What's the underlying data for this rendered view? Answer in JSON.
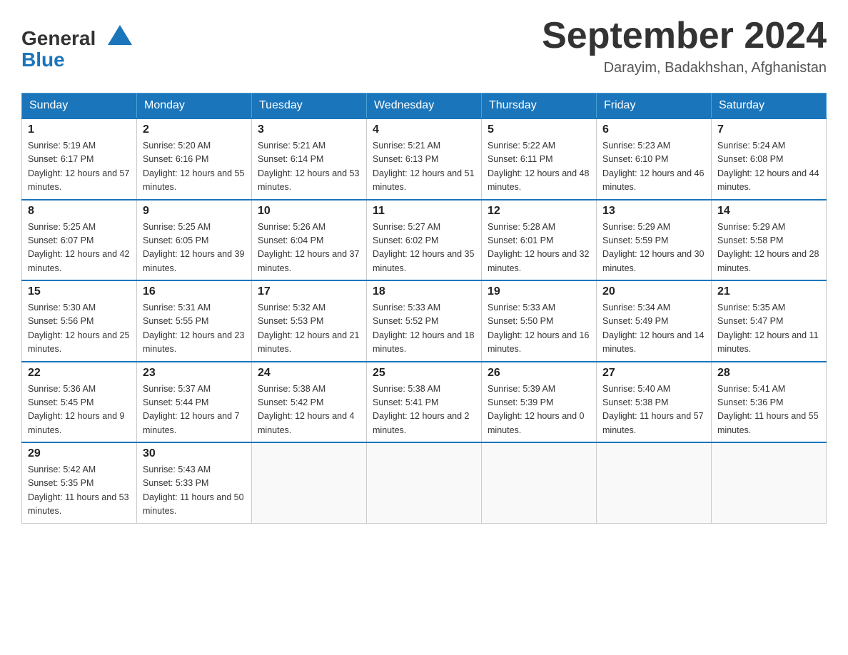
{
  "header": {
    "logo_general": "General",
    "logo_blue": "Blue",
    "main_title": "September 2024",
    "subtitle": "Darayim, Badakhshan, Afghanistan"
  },
  "days_of_week": [
    "Sunday",
    "Monday",
    "Tuesday",
    "Wednesday",
    "Thursday",
    "Friday",
    "Saturday"
  ],
  "weeks": [
    [
      {
        "day": "1",
        "sunrise": "5:19 AM",
        "sunset": "6:17 PM",
        "daylight": "12 hours and 57 minutes."
      },
      {
        "day": "2",
        "sunrise": "5:20 AM",
        "sunset": "6:16 PM",
        "daylight": "12 hours and 55 minutes."
      },
      {
        "day": "3",
        "sunrise": "5:21 AM",
        "sunset": "6:14 PM",
        "daylight": "12 hours and 53 minutes."
      },
      {
        "day": "4",
        "sunrise": "5:21 AM",
        "sunset": "6:13 PM",
        "daylight": "12 hours and 51 minutes."
      },
      {
        "day": "5",
        "sunrise": "5:22 AM",
        "sunset": "6:11 PM",
        "daylight": "12 hours and 48 minutes."
      },
      {
        "day": "6",
        "sunrise": "5:23 AM",
        "sunset": "6:10 PM",
        "daylight": "12 hours and 46 minutes."
      },
      {
        "day": "7",
        "sunrise": "5:24 AM",
        "sunset": "6:08 PM",
        "daylight": "12 hours and 44 minutes."
      }
    ],
    [
      {
        "day": "8",
        "sunrise": "5:25 AM",
        "sunset": "6:07 PM",
        "daylight": "12 hours and 42 minutes."
      },
      {
        "day": "9",
        "sunrise": "5:25 AM",
        "sunset": "6:05 PM",
        "daylight": "12 hours and 39 minutes."
      },
      {
        "day": "10",
        "sunrise": "5:26 AM",
        "sunset": "6:04 PM",
        "daylight": "12 hours and 37 minutes."
      },
      {
        "day": "11",
        "sunrise": "5:27 AM",
        "sunset": "6:02 PM",
        "daylight": "12 hours and 35 minutes."
      },
      {
        "day": "12",
        "sunrise": "5:28 AM",
        "sunset": "6:01 PM",
        "daylight": "12 hours and 32 minutes."
      },
      {
        "day": "13",
        "sunrise": "5:29 AM",
        "sunset": "5:59 PM",
        "daylight": "12 hours and 30 minutes."
      },
      {
        "day": "14",
        "sunrise": "5:29 AM",
        "sunset": "5:58 PM",
        "daylight": "12 hours and 28 minutes."
      }
    ],
    [
      {
        "day": "15",
        "sunrise": "5:30 AM",
        "sunset": "5:56 PM",
        "daylight": "12 hours and 25 minutes."
      },
      {
        "day": "16",
        "sunrise": "5:31 AM",
        "sunset": "5:55 PM",
        "daylight": "12 hours and 23 minutes."
      },
      {
        "day": "17",
        "sunrise": "5:32 AM",
        "sunset": "5:53 PM",
        "daylight": "12 hours and 21 minutes."
      },
      {
        "day": "18",
        "sunrise": "5:33 AM",
        "sunset": "5:52 PM",
        "daylight": "12 hours and 18 minutes."
      },
      {
        "day": "19",
        "sunrise": "5:33 AM",
        "sunset": "5:50 PM",
        "daylight": "12 hours and 16 minutes."
      },
      {
        "day": "20",
        "sunrise": "5:34 AM",
        "sunset": "5:49 PM",
        "daylight": "12 hours and 14 minutes."
      },
      {
        "day": "21",
        "sunrise": "5:35 AM",
        "sunset": "5:47 PM",
        "daylight": "12 hours and 11 minutes."
      }
    ],
    [
      {
        "day": "22",
        "sunrise": "5:36 AM",
        "sunset": "5:45 PM",
        "daylight": "12 hours and 9 minutes."
      },
      {
        "day": "23",
        "sunrise": "5:37 AM",
        "sunset": "5:44 PM",
        "daylight": "12 hours and 7 minutes."
      },
      {
        "day": "24",
        "sunrise": "5:38 AM",
        "sunset": "5:42 PM",
        "daylight": "12 hours and 4 minutes."
      },
      {
        "day": "25",
        "sunrise": "5:38 AM",
        "sunset": "5:41 PM",
        "daylight": "12 hours and 2 minutes."
      },
      {
        "day": "26",
        "sunrise": "5:39 AM",
        "sunset": "5:39 PM",
        "daylight": "12 hours and 0 minutes."
      },
      {
        "day": "27",
        "sunrise": "5:40 AM",
        "sunset": "5:38 PM",
        "daylight": "11 hours and 57 minutes."
      },
      {
        "day": "28",
        "sunrise": "5:41 AM",
        "sunset": "5:36 PM",
        "daylight": "11 hours and 55 minutes."
      }
    ],
    [
      {
        "day": "29",
        "sunrise": "5:42 AM",
        "sunset": "5:35 PM",
        "daylight": "11 hours and 53 minutes."
      },
      {
        "day": "30",
        "sunrise": "5:43 AM",
        "sunset": "5:33 PM",
        "daylight": "11 hours and 50 minutes."
      },
      null,
      null,
      null,
      null,
      null
    ]
  ]
}
